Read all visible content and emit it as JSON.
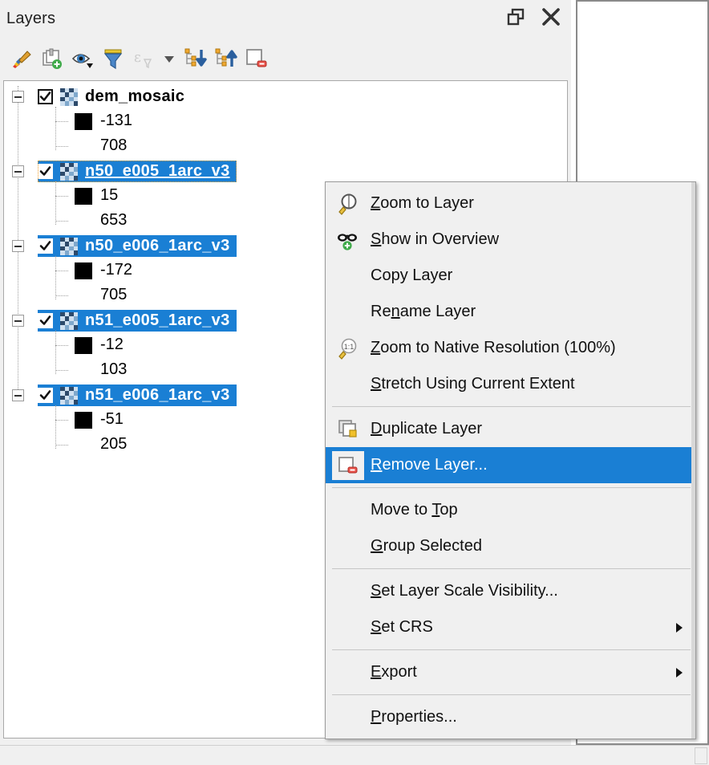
{
  "panel": {
    "title": "Layers",
    "header_buttons": [
      {
        "name": "undock-icon",
        "label": "Undock panel"
      },
      {
        "name": "close-icon",
        "label": "Close panel"
      }
    ],
    "toolbar": [
      {
        "name": "open-layer-styling-panel-icon",
        "label": "Open the Layer Styling panel",
        "enabled": true
      },
      {
        "name": "add-group-icon",
        "label": "Add Group",
        "enabled": true
      },
      {
        "name": "manage-map-themes-icon",
        "label": "Manage Map Themes",
        "enabled": true
      },
      {
        "name": "filter-legend-icon",
        "label": "Filter Legend",
        "enabled": true
      },
      {
        "name": "filter-legend-by-expression-icon",
        "label": "Filter Legend by Expression",
        "enabled": false
      },
      {
        "name": "expression-dropdown-icon",
        "label": "Expression options",
        "enabled": true
      },
      {
        "name": "expand-all-icon",
        "label": "Expand All",
        "enabled": true
      },
      {
        "name": "collapse-all-icon",
        "label": "Collapse All",
        "enabled": true
      },
      {
        "name": "remove-layer-group-icon",
        "label": "Remove Layer/Group",
        "enabled": true
      }
    ]
  },
  "layers": [
    {
      "name": "dem_mosaic",
      "checked": true,
      "selected": false,
      "current": false,
      "expanded": true,
      "legend": [
        {
          "value": "-131",
          "swatch": "#000000",
          "has_swatch": true
        },
        {
          "value": "708",
          "swatch": "",
          "has_swatch": false
        }
      ]
    },
    {
      "name": "n50_e005_1arc_v3",
      "checked": true,
      "selected": true,
      "current": true,
      "expanded": true,
      "legend": [
        {
          "value": "15",
          "swatch": "#000000",
          "has_swatch": true
        },
        {
          "value": "653",
          "swatch": "",
          "has_swatch": false
        }
      ]
    },
    {
      "name": "n50_e006_1arc_v3",
      "checked": true,
      "selected": true,
      "current": false,
      "expanded": true,
      "legend": [
        {
          "value": "-172",
          "swatch": "#000000",
          "has_swatch": true
        },
        {
          "value": "705",
          "swatch": "",
          "has_swatch": false
        }
      ]
    },
    {
      "name": "n51_e005_1arc_v3",
      "checked": true,
      "selected": true,
      "current": false,
      "expanded": true,
      "legend": [
        {
          "value": "-12",
          "swatch": "#000000",
          "has_swatch": true
        },
        {
          "value": "103",
          "swatch": "",
          "has_swatch": false
        }
      ]
    },
    {
      "name": "n51_e006_1arc_v3",
      "checked": true,
      "selected": true,
      "current": false,
      "expanded": true,
      "legend": [
        {
          "value": "-51",
          "swatch": "#000000",
          "has_swatch": true
        },
        {
          "value": "205",
          "swatch": "",
          "has_swatch": false
        }
      ]
    }
  ],
  "context_menu": {
    "items": [
      {
        "type": "item",
        "label": "Zoom to Layer",
        "mnemonic": "Z",
        "icon": "zoom-to-layer-icon",
        "highlighted": false,
        "submenu": false
      },
      {
        "type": "item",
        "label": "Show in Overview",
        "mnemonic": "S",
        "icon": "show-in-overview-icon",
        "highlighted": false,
        "submenu": false
      },
      {
        "type": "item",
        "label": "Copy Layer",
        "mnemonic": "",
        "icon": "",
        "highlighted": false,
        "submenu": false
      },
      {
        "type": "item",
        "label": "Rename Layer",
        "mnemonic": "n",
        "icon": "",
        "highlighted": false,
        "submenu": false
      },
      {
        "type": "item",
        "label": "Zoom to Native Resolution (100%)",
        "mnemonic": "Z",
        "icon": "zoom-native-resolution-icon",
        "highlighted": false,
        "submenu": false
      },
      {
        "type": "item",
        "label": "Stretch Using Current Extent",
        "mnemonic": "S",
        "icon": "",
        "highlighted": false,
        "submenu": false
      },
      {
        "type": "separator"
      },
      {
        "type": "item",
        "label": "Duplicate Layer",
        "mnemonic": "D",
        "icon": "duplicate-layer-icon",
        "highlighted": false,
        "submenu": false
      },
      {
        "type": "item",
        "label": "Remove Layer...",
        "mnemonic": "R",
        "icon": "remove-layer-icon",
        "highlighted": true,
        "submenu": false
      },
      {
        "type": "separator"
      },
      {
        "type": "item",
        "label": "Move to Top",
        "mnemonic": "T",
        "icon": "",
        "highlighted": false,
        "submenu": false
      },
      {
        "type": "item",
        "label": "Group Selected",
        "mnemonic": "G",
        "icon": "",
        "highlighted": false,
        "submenu": false
      },
      {
        "type": "separator"
      },
      {
        "type": "item",
        "label": "Set Layer Scale Visibility...",
        "mnemonic": "S",
        "icon": "",
        "highlighted": false,
        "submenu": false
      },
      {
        "type": "item",
        "label": "Set CRS",
        "mnemonic": "S",
        "icon": "",
        "highlighted": false,
        "submenu": true
      },
      {
        "type": "separator"
      },
      {
        "type": "item",
        "label": "Export",
        "mnemonic": "E",
        "icon": "",
        "highlighted": false,
        "submenu": true
      },
      {
        "type": "separator"
      },
      {
        "type": "item",
        "label": "Properties...",
        "mnemonic": "P",
        "icon": "",
        "highlighted": false,
        "submenu": false
      }
    ]
  },
  "colors": {
    "selection_blue": "#1a7fd4",
    "panel_bg": "#f0f0f0",
    "tree_bg": "#ffffff",
    "raster_dark": "#2d4a6b",
    "raster_light": "#cfe0f0"
  }
}
